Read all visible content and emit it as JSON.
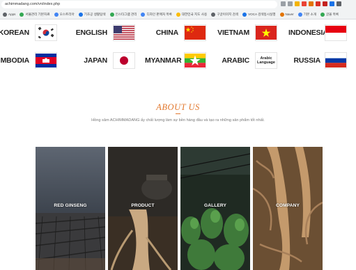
{
  "browser": {
    "url": "achimmadang.com/vn/index.php",
    "bookmarks": [
      "Apps",
      "서울관리 기본자료",
      "오스트리아",
      "기초공 생활탐색",
      "인스타그램 관리",
      "디자인 판매처 목록",
      "대한민국 지도 사용",
      "구글이미지 검색",
      "VOCA 검색동시실행",
      "Naver",
      "기본 소개",
      "글꼴 목록"
    ]
  },
  "languages": [
    {
      "name": "KOREAN",
      "flag": "korea-flag-icon"
    },
    {
      "name": "ENGLISH",
      "flag": "usa-flag-icon"
    },
    {
      "name": "CHINA",
      "flag": "china-flag-icon"
    },
    {
      "name": "VIETNAM",
      "flag": "vietnam-flag-icon"
    },
    {
      "name": "INDONESIA",
      "flag": "indonesia-flag-icon"
    },
    {
      "name": "MBODIA",
      "flag": "cambodia-flag-icon"
    },
    {
      "name": "JAPAN",
      "flag": "japan-flag-icon"
    },
    {
      "name": "MYANMAR",
      "flag": "myanmar-flag-icon"
    },
    {
      "name": "ARABIC",
      "flag": "arabic-language-icon",
      "badge": [
        "Arabic",
        "Language"
      ]
    },
    {
      "name": "RUSSIA",
      "flag": "russia-flag-icon"
    }
  ],
  "about": {
    "title": "ABOUT US",
    "description": "Hồng sâm ACHIMMADANG ấy chất lượng làm sự bền hàng đầu và tạo ra những sản phẩm tốt nhất."
  },
  "cards": [
    {
      "label": "RED GINSENG"
    },
    {
      "label": "PRODUCT"
    },
    {
      "label": "GALLERY"
    },
    {
      "label": "COMPANY"
    }
  ],
  "colors": {
    "accent": "#e2782e"
  }
}
